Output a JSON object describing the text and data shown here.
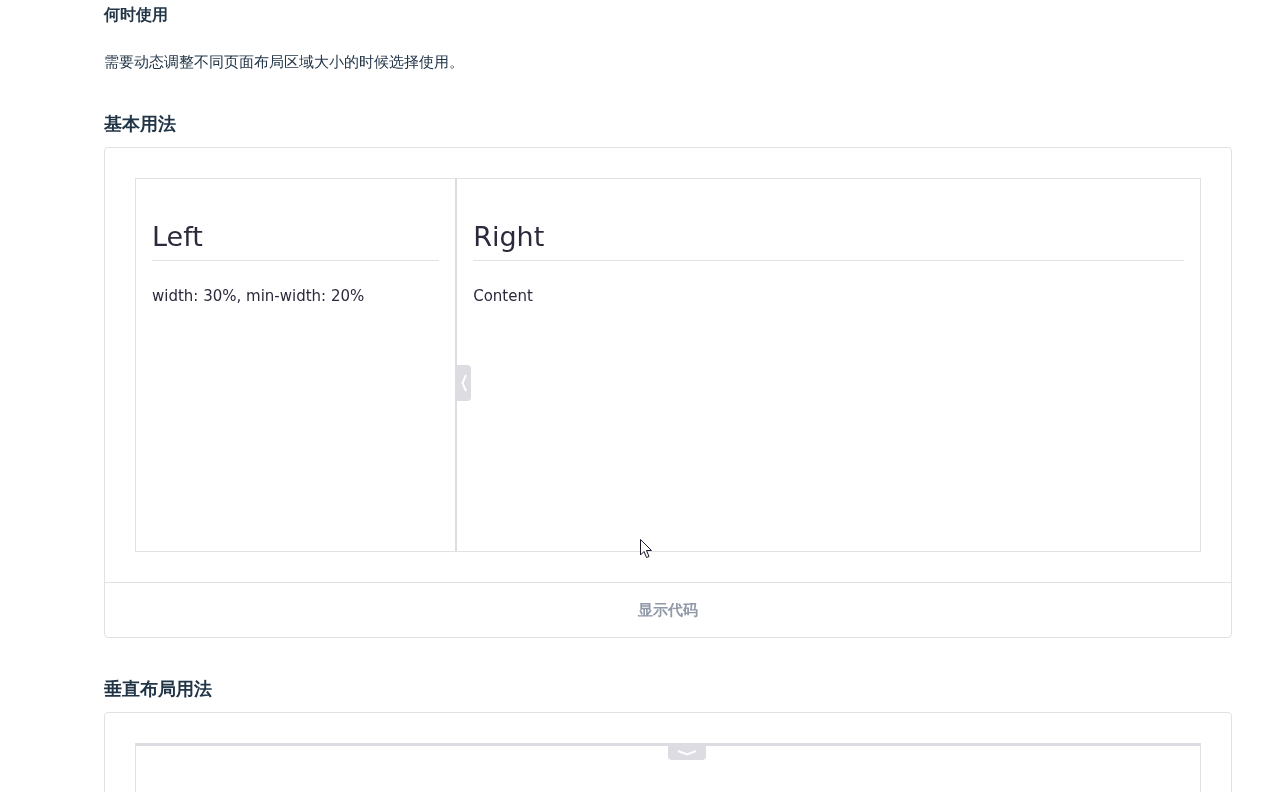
{
  "when_to_use": {
    "heading": "何时使用",
    "text": "需要动态调整不同页面布局区域大小的时候选择使用。"
  },
  "demos": [
    {
      "title": "基本用法",
      "kind": "horizontal",
      "panes": [
        {
          "title": "Left",
          "text": "width: 30%, min-width: 20%"
        },
        {
          "title": "Right",
          "text": "Content"
        }
      ],
      "footer_button": "显示代码"
    },
    {
      "title": "垂直布局用法",
      "kind": "vertical"
    }
  ]
}
